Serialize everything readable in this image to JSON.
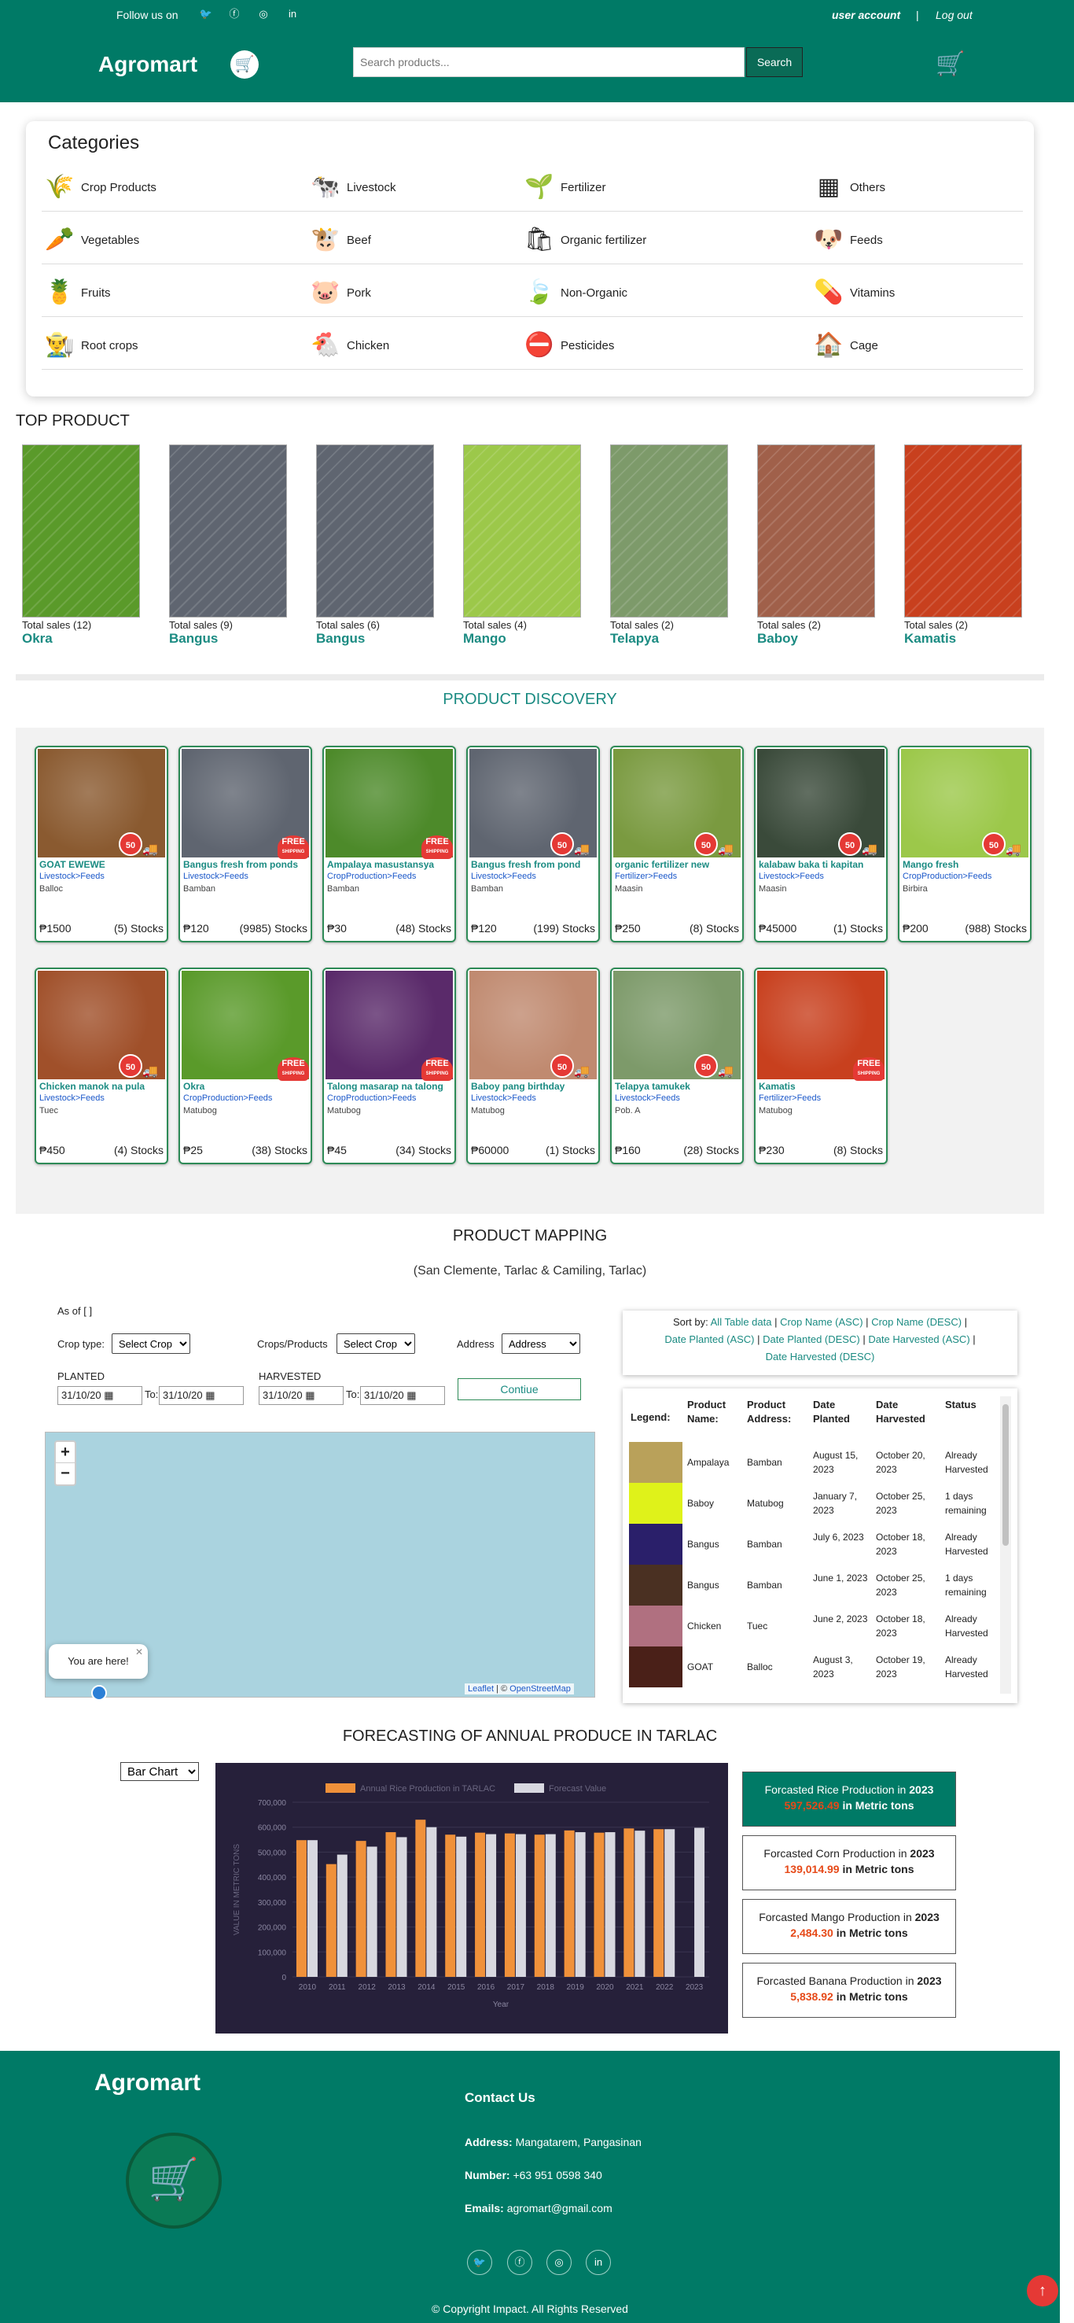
{
  "topbar": {
    "follow": "Follow us on",
    "user_account": "user account",
    "separator": "|",
    "logout": "Log out"
  },
  "header": {
    "logo": "Agromart",
    "search_placeholder": "Search products...",
    "search_button": "Search"
  },
  "categories": {
    "title": "Categories",
    "items": [
      {
        "label": "Crop Products",
        "icon": "wheat-icon"
      },
      {
        "label": "Livestock",
        "icon": "barn-icon"
      },
      {
        "label": "Fertilizer",
        "icon": "sprout-icon"
      },
      {
        "label": "Others",
        "icon": "grid-icon"
      },
      {
        "label": "Vegetables",
        "icon": "vegetables-icon"
      },
      {
        "label": "Beef",
        "icon": "cow-icon"
      },
      {
        "label": "Organic fertilizer",
        "icon": "organic-bag-icon"
      },
      {
        "label": "Feeds",
        "icon": "feed-bag-icon"
      },
      {
        "label": "Fruits",
        "icon": "fruits-icon"
      },
      {
        "label": "Pork",
        "icon": "pig-icon"
      },
      {
        "label": "Non-Organic",
        "icon": "leaf-icon"
      },
      {
        "label": "Vitamins",
        "icon": "vitamin-icon"
      },
      {
        "label": "Root crops",
        "icon": "farmer-icon"
      },
      {
        "label": "Chicken",
        "icon": "chicken-icon"
      },
      {
        "label": "Pesticides",
        "icon": "no-bug-icon"
      },
      {
        "label": "Cage",
        "icon": "cage-icon"
      }
    ]
  },
  "top_product": {
    "title": "TOP PRODUCT",
    "items": [
      {
        "sales": "Total sales (12)",
        "name": "Okra",
        "color": "#5a9a2a"
      },
      {
        "sales": "Total sales (9)",
        "name": "Bangus",
        "color": "#5f6570"
      },
      {
        "sales": "Total sales (6)",
        "name": "Bangus",
        "color": "#5f6570"
      },
      {
        "sales": "Total sales (4)",
        "name": "Mango",
        "color": "#9cc84a"
      },
      {
        "sales": "Total sales (2)",
        "name": "Telapya",
        "color": "#7d9a6a"
      },
      {
        "sales": "Total sales (2)",
        "name": "Baboy",
        "color": "#a0604a"
      },
      {
        "sales": "Total sales (2)",
        "name": "Kamatis",
        "color": "#c8401e"
      }
    ]
  },
  "discovery": {
    "title": "PRODUCT DISCOVERY",
    "badge_50": "50",
    "free_text": "FREE",
    "free_sub": "SHIPPING",
    "products": [
      {
        "name": "GOAT EWEWE",
        "cat": "Livestock>Feeds",
        "addr": "Balloc",
        "price": "₱1500",
        "stock": "(5) Stocks",
        "badge": "50",
        "color": "#8a5a30"
      },
      {
        "name": "Bangus fresh from ponds",
        "cat": "Livestock>Feeds",
        "addr": "Bamban",
        "price": "₱120",
        "stock": "(9985) Stocks",
        "badge": "free",
        "color": "#5f6570"
      },
      {
        "name": "Ampalaya masustansya",
        "cat": "CropProduction>Feeds",
        "addr": "Bamban",
        "price": "₱30",
        "stock": "(48) Stocks",
        "badge": "free",
        "color": "#4d8a2a"
      },
      {
        "name": "Bangus fresh from pond",
        "cat": "Livestock>Feeds",
        "addr": "Bamban",
        "price": "₱120",
        "stock": "(199) Stocks",
        "badge": "50",
        "color": "#5f6570"
      },
      {
        "name": "organic fertilizer new",
        "cat": "Fertilizer>Feeds",
        "addr": "Maasin",
        "price": "₱250",
        "stock": "(8) Stocks",
        "badge": "50",
        "color": "#7a9a40"
      },
      {
        "name": "kalabaw baka ti kapitan",
        "cat": "Livestock>Feeds",
        "addr": "Maasin",
        "price": "₱45000",
        "stock": "(1) Stocks",
        "badge": "50",
        "color": "#3a4a3a"
      },
      {
        "name": "Mango fresh",
        "cat": "CropProduction>Feeds",
        "addr": "Birbira",
        "price": "₱200",
        "stock": "(988) Stocks",
        "badge": "50",
        "color": "#9cc84a"
      },
      {
        "name": "Chicken manok na pula",
        "cat": "Livestock>Feeds",
        "addr": "Tuec",
        "price": "₱450",
        "stock": "(4) Stocks",
        "badge": "50",
        "color": "#a0502a"
      },
      {
        "name": "Okra",
        "cat": "CropProduction>Feeds",
        "addr": "Matubog",
        "price": "₱25",
        "stock": "(38) Stocks",
        "badge": "free",
        "color": "#5a9a2a"
      },
      {
        "name": "Talong masarap na talong",
        "cat": "CropProduction>Feeds",
        "addr": "Matubog",
        "price": "₱45",
        "stock": "(34) Stocks",
        "badge": "free",
        "color": "#5a2a6a"
      },
      {
        "name": "Baboy pang birthday",
        "cat": "Livestock>Feeds",
        "addr": "Matubog",
        "price": "₱60000",
        "stock": "(1) Stocks",
        "badge": "50",
        "color": "#c08a70"
      },
      {
        "name": "Telapya tamukek",
        "cat": "Livestock>Feeds",
        "addr": "Pob. A",
        "price": "₱160",
        "stock": "(28) Stocks",
        "badge": "50",
        "color": "#7d9a6a"
      },
      {
        "name": "Kamatis",
        "cat": "Fertilizer>Feeds",
        "addr": "Matubog",
        "price": "₱230",
        "stock": "(8) Stocks",
        "badge": "free",
        "color": "#c8401e"
      }
    ]
  },
  "mapping": {
    "title": "PRODUCT MAPPING",
    "subtitle": "(San Clemente, Tarlac & Camiling, Tarlac)",
    "as_of": "As of [ ]",
    "crop_type_label": "Crop type:",
    "crop_type_value": "Select Crop",
    "crops_label": "Crops/Products",
    "crops_value": "Select Crop",
    "address_label": "Address",
    "address_value": "Address",
    "planted_label": "PLANTED",
    "harvested_label": "HARVESTED",
    "to_label": "To:",
    "date_value": "31/10/20",
    "continue": "Contiue",
    "map_popup": "You are here!",
    "attribution_leaflet": "Leaflet",
    "attribution_sep": " | © ",
    "attribution_osm": "OpenStreetMap",
    "sort_label": "Sort by:",
    "sort_options": [
      "All Table data",
      "Crop Name (ASC)",
      "Crop Name (DESC)",
      "Date Planted (ASC)",
      "Date Planted (DESC)",
      "Date Harvested (ASC)",
      "Date Harvested (DESC)"
    ],
    "table_headers": [
      "Legend:",
      "Product Name:",
      "Product Address:",
      "Date Planted",
      "Date Harvested",
      "Status"
    ],
    "rows": [
      {
        "color": "#b9a15a",
        "name": "Ampalaya",
        "addr": "Bamban",
        "planted": "August 15, 2023",
        "harvested": "October 20, 2023",
        "status": "Already Harvested"
      },
      {
        "color": "#dff21a",
        "name": "Baboy",
        "addr": "Matubog",
        "planted": "January 7, 2023",
        "harvested": "October 25, 2023",
        "status": "1 days remaining"
      },
      {
        "color": "#2a1f6a",
        "name": "Bangus",
        "addr": "Bamban",
        "planted": "July 6, 2023",
        "harvested": "October 18, 2023",
        "status": "Already Harvested"
      },
      {
        "color": "#4a3022",
        "name": "Bangus",
        "addr": "Bamban",
        "planted": "June 1, 2023",
        "harvested": "October 25, 2023",
        "status": "1 days remaining"
      },
      {
        "color": "#b07080",
        "name": "Chicken",
        "addr": "Tuec",
        "planted": "June 2, 2023",
        "harvested": "October 18, 2023",
        "status": "Already Harvested"
      },
      {
        "color": "#4a2018",
        "name": "GOAT",
        "addr": "Balloc",
        "planted": "August 3, 2023",
        "harvested": "October 19, 2023",
        "status": "Already Harvested"
      }
    ]
  },
  "forecast": {
    "title": "FORECASTING OF ANNUAL PRODUCE IN TARLAC",
    "chart_select": "Bar Chart",
    "boxes": [
      {
        "pre": "Forcasted Rice Production in",
        "year": "2023",
        "value": "597,526.49",
        "unit": "in Metric tons"
      },
      {
        "pre": "Forcasted Corn Production in",
        "year": "2023",
        "value": "139,014.99",
        "unit": "in Metric tons"
      },
      {
        "pre": "Forcasted Mango Production in",
        "year": "2023",
        "value": "2,484.30",
        "unit": "in Metric tons"
      },
      {
        "pre": "Forcasted Banana Production in",
        "year": "2023",
        "value": "5,838.92",
        "unit": "in Metric tons"
      }
    ]
  },
  "chart_data": {
    "type": "bar",
    "categories": [
      "2010",
      "2011",
      "2012",
      "2013",
      "2014",
      "2015",
      "2016",
      "2017",
      "2018",
      "2019",
      "2020",
      "2021",
      "2022",
      "2023"
    ],
    "series": [
      {
        "name": "Annual Rice Production in TARLAC",
        "color": "#f0913a",
        "values": [
          548000,
          452000,
          545000,
          580000,
          630000,
          570000,
          578000,
          575000,
          570000,
          587000,
          578000,
          595000,
          592000,
          null
        ]
      },
      {
        "name": "Forecast Value",
        "color": "#d8d8e0",
        "values": [
          548000,
          490000,
          522000,
          560000,
          600000,
          562000,
          572000,
          572000,
          572000,
          580000,
          580000,
          586000,
          592000,
          597526
        ]
      }
    ],
    "xlabel": "Year",
    "ylabel": "VALUE IN METRIC TONS",
    "ylim": [
      0,
      700000
    ],
    "yticks": [
      "0",
      "100,000",
      "200,000",
      "300,000",
      "400,000",
      "500,000",
      "600,000",
      "700,000"
    ],
    "legend": "top"
  },
  "footer": {
    "title": "Agromart",
    "contact": "Contact Us",
    "address_label": "Address:",
    "address": "Mangatarem, Pangasinan",
    "number_label": "Number:",
    "number": "+63 951 0598 340",
    "email_label": "Emails:",
    "email": "agromart@gmail.com",
    "copyright": "© Copyright Impact. All Rights Reserved"
  }
}
